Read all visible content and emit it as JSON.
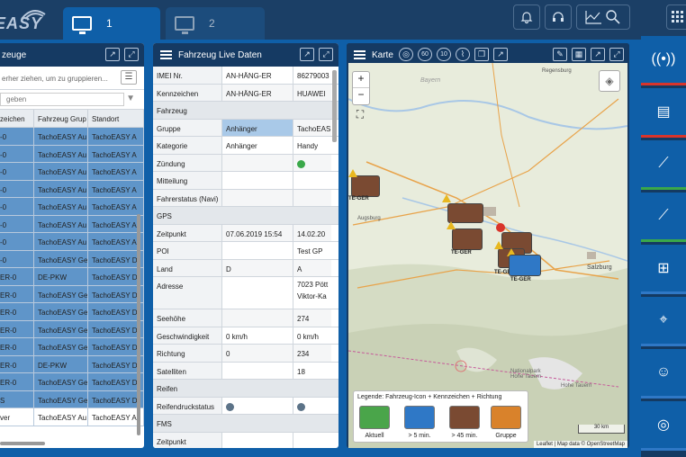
{
  "app": {
    "logo_text": "EASY"
  },
  "tabs": [
    {
      "label": "1"
    },
    {
      "label": "2"
    }
  ],
  "toolbar_icons": [
    "bell-icon",
    "headset-icon",
    "chart-search-icon",
    "grid-icon"
  ],
  "vehicles_panel": {
    "title": "zeuge",
    "group_hint": "erher ziehen, um zu gruppieren...",
    "filter_placeholder": "geben",
    "columns": [
      "zeichen",
      "Fahrzeug Grup",
      "Standort"
    ],
    "rows": [
      {
        "c1": "-0",
        "c2": "TachoEASY Au",
        "c3": "TachoEASY A",
        "selected": true
      },
      {
        "c1": "-0",
        "c2": "TachoEASY Au",
        "c3": "TachoEASY A",
        "selected": true
      },
      {
        "c1": "-0",
        "c2": "TachoEASY Au",
        "c3": "TachoEASY A",
        "selected": true
      },
      {
        "c1": "-0",
        "c2": "TachoEASY Au",
        "c3": "TachoEASY A",
        "selected": true
      },
      {
        "c1": "-0",
        "c2": "TachoEASY Au",
        "c3": "TachoEASY A",
        "selected": true
      },
      {
        "c1": "-0",
        "c2": "TachoEASY Au",
        "c3": "TachoEASY A",
        "selected": true
      },
      {
        "c1": "-0",
        "c2": "TachoEASY Au",
        "c3": "TachoEASY A",
        "selected": true
      },
      {
        "c1": "-0",
        "c2": "TachoEASY Ge",
        "c3": "TachoEASY D",
        "selected": true
      },
      {
        "c1": "ER-0",
        "c2": "DE-PKW",
        "c3": "TachoEASY D",
        "selected": true
      },
      {
        "c1": "ER-0",
        "c2": "TachoEASY Ge",
        "c3": "TachoEASY D",
        "selected": true
      },
      {
        "c1": "ER-0",
        "c2": "TachoEASY Ge",
        "c3": "TachoEASY D",
        "selected": true
      },
      {
        "c1": "ER-0",
        "c2": "TachoEASY Ge",
        "c3": "TachoEASY D",
        "selected": true
      },
      {
        "c1": "ER-0",
        "c2": "TachoEASY Ge",
        "c3": "TachoEASY D",
        "selected": true
      },
      {
        "c1": "ER-0",
        "c2": "DE-PKW",
        "c3": "TachoEASY D",
        "selected": true
      },
      {
        "c1": "ER-0",
        "c2": "TachoEASY Ge",
        "c3": "TachoEASY D",
        "selected": true
      },
      {
        "c1": "S",
        "c2": "TachoEASY Ge",
        "c3": "TachoEASY D",
        "selected": true
      },
      {
        "c1": "ver",
        "c2": "TachoEASY Au",
        "c3": "TachoEASY A",
        "selected": false
      }
    ]
  },
  "live_panel": {
    "title": "Fahrzeug Live Daten",
    "rows": [
      {
        "type": "kv",
        "k": "IMEI Nr.",
        "v1": "AN-HÄNG-ER",
        "v2": "86279003"
      },
      {
        "type": "kv",
        "k": "Kennzeichen",
        "v1": "AN-HÄNG-ER",
        "v2": "HUAWEI"
      },
      {
        "type": "sec",
        "k": "Fahrzeug"
      },
      {
        "type": "kv",
        "k": "Gruppe",
        "v1": "Anhänger",
        "v2": "TachoEAS",
        "hl": true
      },
      {
        "type": "kv",
        "k": "Kategorie",
        "v1": "Anhänger",
        "v2": "Handy"
      },
      {
        "type": "kv",
        "k": "Zündung",
        "v1": "",
        "v2": "",
        "dot2": "#3aa84a"
      },
      {
        "type": "kv",
        "k": "Mitteilung",
        "v1": "",
        "v2": ""
      },
      {
        "type": "kv",
        "k": "Fahrerstatus (Navi)",
        "v1": "",
        "v2": ""
      },
      {
        "type": "sec",
        "k": "GPS"
      },
      {
        "type": "kv",
        "k": "Zeitpunkt",
        "v1": "07.06.2019 15:54",
        "v2": "14.02.20"
      },
      {
        "type": "kv",
        "k": "POI",
        "v1": "",
        "v2": "Test GP"
      },
      {
        "type": "kv",
        "k": "Land",
        "v1": "D",
        "v2": "A"
      },
      {
        "type": "kv2",
        "k": "Adresse",
        "v1": "",
        "v2a": "7023 Pött",
        "v2b": "Viktor-Ka"
      },
      {
        "type": "kv",
        "k": "Seehöhe",
        "v1": "",
        "v2": "274"
      },
      {
        "type": "kv",
        "k": "Geschwindigkeit",
        "v1": "0 km/h",
        "v2": "0 km/h"
      },
      {
        "type": "kv",
        "k": "Richtung",
        "v1": "0",
        "v2": "234"
      },
      {
        "type": "kv",
        "k": "Satelliten",
        "v1": "",
        "v2": "18"
      },
      {
        "type": "sec",
        "k": "Reifen"
      },
      {
        "type": "kv",
        "k": "Reifendruckstatus",
        "v1": "",
        "v2": "",
        "dot1": "#5c7388",
        "dot2": "#5c7388"
      },
      {
        "type": "sec",
        "k": "FMS"
      },
      {
        "type": "kv",
        "k": "Zeitpunkt",
        "v1": "",
        "v2": ""
      }
    ]
  },
  "map_panel": {
    "title": "Karte",
    "toolbar_values": [
      "60",
      "10"
    ],
    "zoom_in": "+",
    "zoom_out": "−",
    "places": [
      "Regensburg",
      "Augsburg",
      "Salzburg",
      "Bayern",
      "Nationalpark Hohe Tauern",
      "Hohe Tauern"
    ],
    "vehicle_labels": [
      "TE-GER",
      "TE-GER",
      "TE-GER",
      "TE-GER",
      "TE-GER",
      "TE-GER"
    ],
    "legend": {
      "title": "Legende: Fahrzeug-Icon + Kennzeichen + Richtung",
      "items": [
        {
          "label": "Aktuell",
          "color": "#4aa54a"
        },
        {
          "label": "> 5 min.",
          "color": "#2f78c6"
        },
        {
          "label": "> 45 min.",
          "color": "#7a4a32"
        },
        {
          "label": "Gruppe",
          "color": "#d9822b"
        }
      ]
    },
    "scale": "30 km",
    "attribution": "Leaflet | Map data © OpenStreetMap"
  },
  "sidebar": {
    "buttons": [
      {
        "icon": "antenna-icon",
        "accent": "#d9342b"
      },
      {
        "icon": "id-card-icon",
        "accent": "#d9342b"
      },
      {
        "icon": "route-icon",
        "accent": "#3aa84a"
      },
      {
        "icon": "route-alt-icon",
        "accent": "#3aa84a"
      },
      {
        "icon": "truck-add-icon",
        "accent": "#2f78c6"
      },
      {
        "icon": "location-pin-icon",
        "accent": "#2f78c6"
      },
      {
        "icon": "user-settings-icon",
        "accent": "#2f78c6"
      },
      {
        "icon": "lifebuoy-icon",
        "accent": "#2f78c6"
      }
    ]
  }
}
